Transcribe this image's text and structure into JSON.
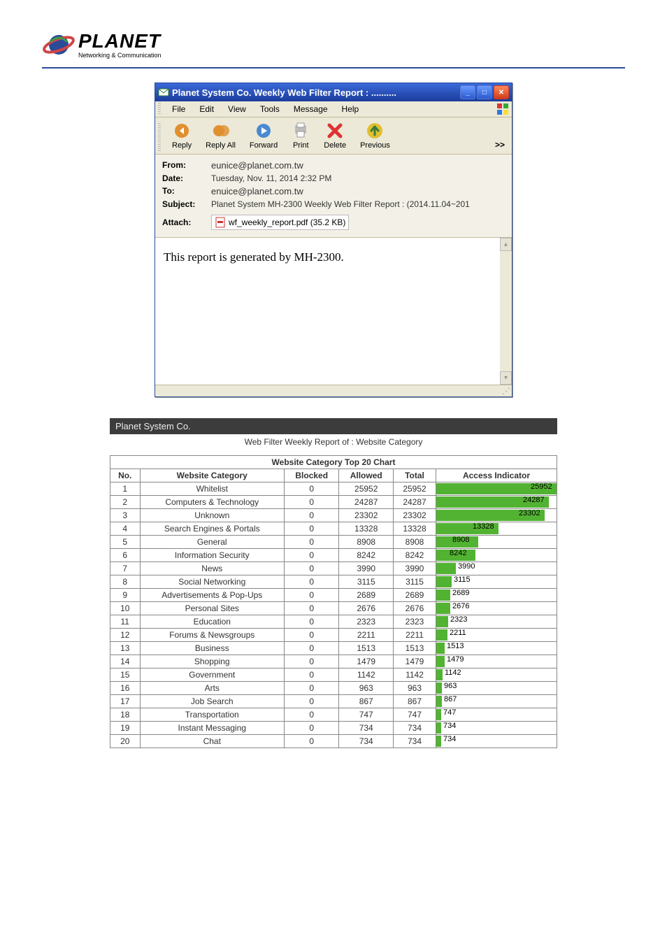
{
  "logo": {
    "title": "PLANET",
    "subtitle": "Networking & Communication"
  },
  "email_window": {
    "title": "Planet System Co. Weekly Web Filter Report : ..........",
    "menu": [
      "File",
      "Edit",
      "View",
      "Tools",
      "Message",
      "Help"
    ],
    "toolbar": {
      "reply": "Reply",
      "reply_all": "Reply All",
      "forward": "Forward",
      "print": "Print",
      "delete": "Delete",
      "previous": "Previous",
      "more": ">>"
    },
    "headers": {
      "from_label": "From:",
      "from": "eunice@planet.com.tw",
      "date_label": "Date:",
      "date": "Tuesday, Nov. 11, 2014 2:32 PM",
      "to_label": "To:",
      "to": "enuice@planet.com.tw",
      "subject_label": "Subject:",
      "subject": "Planet System MH-2300 Weekly Web Filter Report : (2014.11.04~201",
      "attach_label": "Attach:",
      "attach": "wf_weekly_report.pdf (35.2 KB)"
    },
    "body": "This report is generated by MH-2300."
  },
  "report": {
    "company": "Planet System Co.",
    "subtitle": "Web Filter Weekly Report    of : Website Category",
    "table_title": "Website Category Top 20 Chart",
    "columns": [
      "No.",
      "Website Category",
      "Blocked",
      "Allowed",
      "Total",
      "Access Indicator"
    ],
    "rows": [
      {
        "no": 1,
        "cat": "Whitelist",
        "blocked": 0,
        "allowed": 25952,
        "total": 25952
      },
      {
        "no": 2,
        "cat": "Computers & Technology",
        "blocked": 0,
        "allowed": 24287,
        "total": 24287
      },
      {
        "no": 3,
        "cat": "Unknown",
        "blocked": 0,
        "allowed": 23302,
        "total": 23302
      },
      {
        "no": 4,
        "cat": "Search Engines & Portals",
        "blocked": 0,
        "allowed": 13328,
        "total": 13328
      },
      {
        "no": 5,
        "cat": "General",
        "blocked": 0,
        "allowed": 8908,
        "total": 8908
      },
      {
        "no": 6,
        "cat": "Information Security",
        "blocked": 0,
        "allowed": 8242,
        "total": 8242
      },
      {
        "no": 7,
        "cat": "News",
        "blocked": 0,
        "allowed": 3990,
        "total": 3990
      },
      {
        "no": 8,
        "cat": "Social Networking",
        "blocked": 0,
        "allowed": 3115,
        "total": 3115
      },
      {
        "no": 9,
        "cat": "Advertisements & Pop-Ups",
        "blocked": 0,
        "allowed": 2689,
        "total": 2689
      },
      {
        "no": 10,
        "cat": "Personal Sites",
        "blocked": 0,
        "allowed": 2676,
        "total": 2676
      },
      {
        "no": 11,
        "cat": "Education",
        "blocked": 0,
        "allowed": 2323,
        "total": 2323
      },
      {
        "no": 12,
        "cat": "Forums & Newsgroups",
        "blocked": 0,
        "allowed": 2211,
        "total": 2211
      },
      {
        "no": 13,
        "cat": "Business",
        "blocked": 0,
        "allowed": 1513,
        "total": 1513
      },
      {
        "no": 14,
        "cat": "Shopping",
        "blocked": 0,
        "allowed": 1479,
        "total": 1479
      },
      {
        "no": 15,
        "cat": "Government",
        "blocked": 0,
        "allowed": 1142,
        "total": 1142
      },
      {
        "no": 16,
        "cat": "Arts",
        "blocked": 0,
        "allowed": 963,
        "total": 963
      },
      {
        "no": 17,
        "cat": "Job Search",
        "blocked": 0,
        "allowed": 867,
        "total": 867
      },
      {
        "no": 18,
        "cat": "Transportation",
        "blocked": 0,
        "allowed": 747,
        "total": 747
      },
      {
        "no": 19,
        "cat": "Instant Messaging",
        "blocked": 0,
        "allowed": 734,
        "total": 734
      },
      {
        "no": 20,
        "cat": "Chat",
        "blocked": 0,
        "allowed": 734,
        "total": 734
      }
    ]
  },
  "chart_data": {
    "type": "bar",
    "title": "Website Category Top 20 Chart — Access Indicator",
    "xlabel": "Website Category",
    "ylabel": "Total",
    "categories": [
      "Whitelist",
      "Computers & Technology",
      "Unknown",
      "Search Engines & Portals",
      "General",
      "Information Security",
      "News",
      "Social Networking",
      "Advertisements & Pop-Ups",
      "Personal Sites",
      "Education",
      "Forums & Newsgroups",
      "Business",
      "Shopping",
      "Government",
      "Arts",
      "Job Search",
      "Transportation",
      "Instant Messaging",
      "Chat"
    ],
    "values": [
      25952,
      24287,
      23302,
      13328,
      8908,
      8242,
      3990,
      3115,
      2689,
      2676,
      2323,
      2211,
      1513,
      1479,
      1142,
      963,
      867,
      747,
      734,
      734
    ],
    "ylim": [
      0,
      25952
    ]
  }
}
